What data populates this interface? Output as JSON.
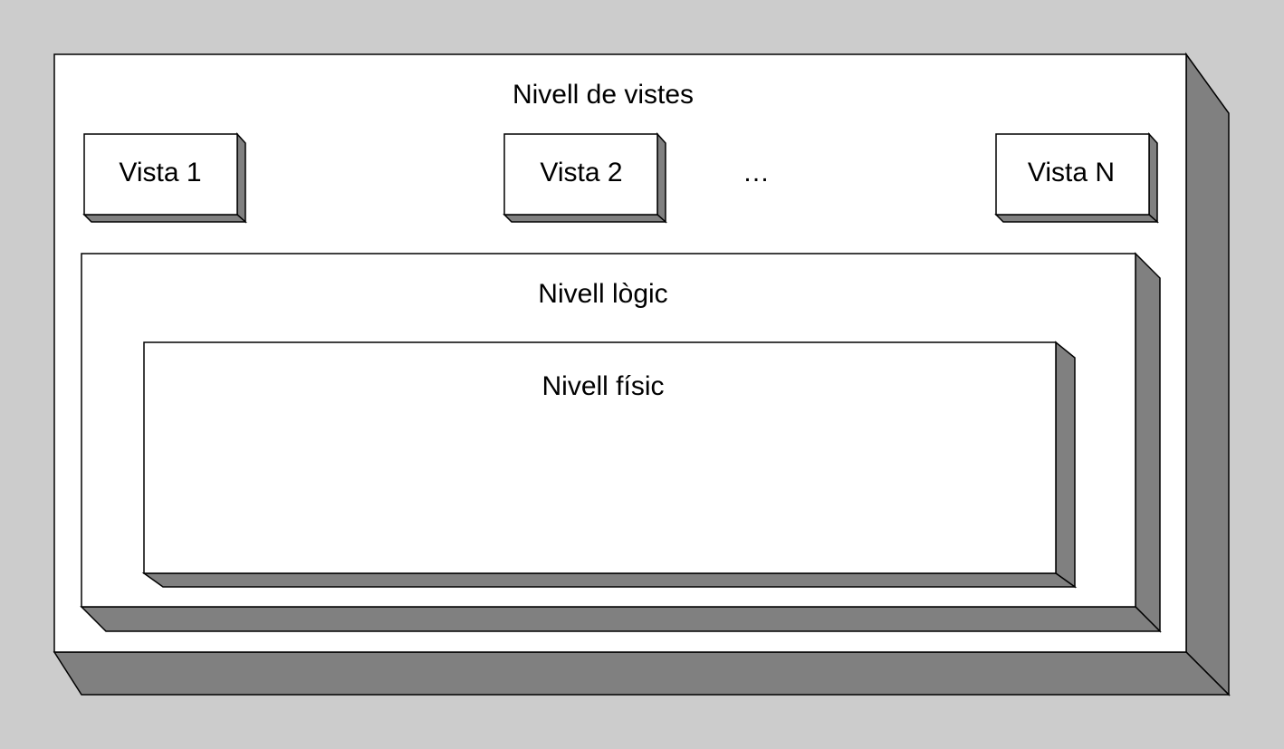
{
  "diagram": {
    "views_level": {
      "title": "Nivell de vistes",
      "views": [
        "Vista 1",
        "Vista 2",
        "Vista N"
      ],
      "ellipsis": "…"
    },
    "logical_level": {
      "title": "Nivell lògic"
    },
    "physical_level": {
      "title": "Nivell físic"
    }
  },
  "colors": {
    "background": "#cccccc",
    "face": "#ffffff",
    "side": "#808080",
    "outline": "#000000"
  }
}
